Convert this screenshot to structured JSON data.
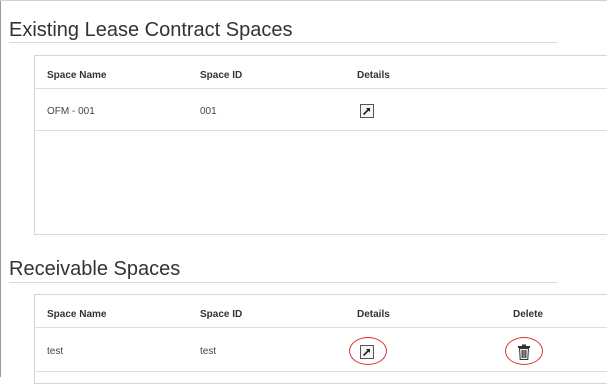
{
  "existing_section": {
    "title": "Existing Lease Contract Spaces",
    "columns": [
      "Space Name",
      "Space ID",
      "Details"
    ],
    "rows": [
      {
        "space_name": "OFM - 001",
        "space_id": "001",
        "details_icon": "open-external-icon"
      }
    ]
  },
  "receivable_section": {
    "title": "Receivable Spaces",
    "columns": [
      "Space Name",
      "Space ID",
      "Details",
      "Delete"
    ],
    "rows": [
      {
        "space_name": "test",
        "space_id": "test",
        "details_icon": "open-external-icon",
        "delete_icon": "trash-icon"
      }
    ]
  },
  "colors": {
    "highlight_circle": "#d9342b",
    "border": "#d6d6d6",
    "text": "#333333"
  }
}
